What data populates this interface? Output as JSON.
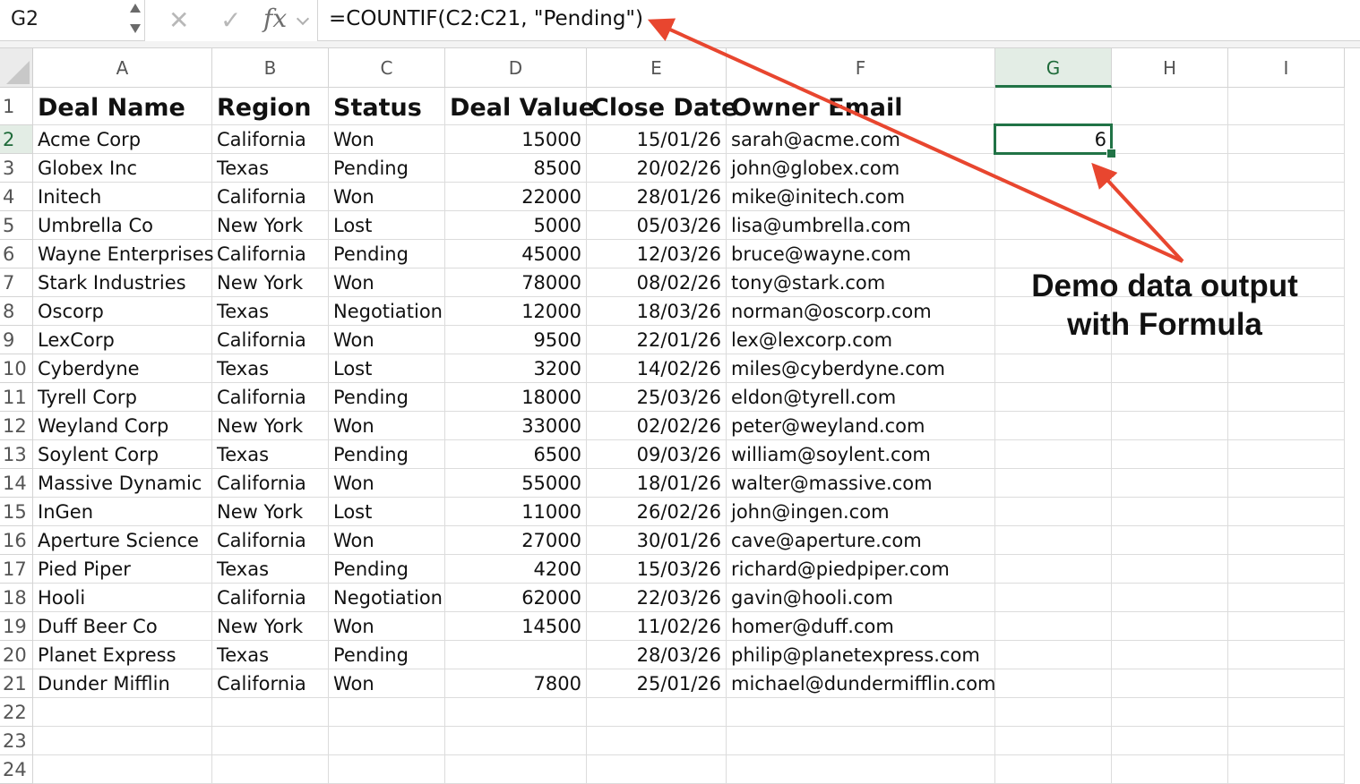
{
  "name_box": {
    "value": "G2"
  },
  "formula_bar": {
    "cancel_icon": "x-icon",
    "enter_icon": "check-icon",
    "fx_label": "fx",
    "formula": "=COUNTIF(C2:C21, \"Pending\")"
  },
  "columns": [
    "A",
    "B",
    "C",
    "D",
    "E",
    "F",
    "G",
    "H",
    "I"
  ],
  "selected_column": "G",
  "selected_row": 2,
  "row_numbers": [
    1,
    2,
    3,
    4,
    5,
    6,
    7,
    8,
    9,
    10,
    11,
    12,
    13,
    14,
    15,
    16,
    17,
    18,
    19,
    20,
    21,
    22,
    23,
    24
  ],
  "header_row": [
    "Deal Name",
    "Region",
    "Status",
    "Deal Value",
    "Close Date",
    "Owner Email"
  ],
  "rows": [
    [
      "Acme Corp",
      "California",
      "Won",
      "15000",
      "15/01/26",
      "sarah@acme.com"
    ],
    [
      "Globex Inc",
      "Texas",
      "Pending",
      "8500",
      "20/02/26",
      "john@globex.com"
    ],
    [
      "Initech",
      "California",
      "Won",
      "22000",
      "28/01/26",
      "mike@initech.com"
    ],
    [
      "Umbrella Co",
      "New York",
      "Lost",
      "5000",
      "05/03/26",
      "lisa@umbrella.com"
    ],
    [
      "Wayne Enterprises",
      "California",
      "Pending",
      "45000",
      "12/03/26",
      "bruce@wayne.com"
    ],
    [
      "Stark Industries",
      "New York",
      "Won",
      "78000",
      "08/02/26",
      "tony@stark.com"
    ],
    [
      "Oscorp",
      "Texas",
      "Negotiation",
      "12000",
      "18/03/26",
      "norman@oscorp.com"
    ],
    [
      "LexCorp",
      "California",
      "Won",
      "9500",
      "22/01/26",
      "lex@lexcorp.com"
    ],
    [
      "Cyberdyne",
      "Texas",
      "Lost",
      "3200",
      "14/02/26",
      "miles@cyberdyne.com"
    ],
    [
      "Tyrell Corp",
      "California",
      "Pending",
      "18000",
      "25/03/26",
      "eldon@tyrell.com"
    ],
    [
      "Weyland Corp",
      "New York",
      "Won",
      "33000",
      "02/02/26",
      "peter@weyland.com"
    ],
    [
      "Soylent Corp",
      "Texas",
      "Pending",
      "6500",
      "09/03/26",
      "william@soylent.com"
    ],
    [
      "Massive Dynamic",
      "California",
      "Won",
      "55000",
      "18/01/26",
      "walter@massive.com"
    ],
    [
      "InGen",
      "New York",
      "Lost",
      "11000",
      "26/02/26",
      "john@ingen.com"
    ],
    [
      "Aperture Science",
      "California",
      "Won",
      "27000",
      "30/01/26",
      "cave@aperture.com"
    ],
    [
      "Pied Piper",
      "Texas",
      "Pending",
      "4200",
      "15/03/26",
      "richard@piedpiper.com"
    ],
    [
      "Hooli",
      "California",
      "Negotiation",
      "62000",
      "22/03/26",
      "gavin@hooli.com"
    ],
    [
      "Duff Beer Co",
      "New York",
      "Won",
      "14500",
      "11/02/26",
      "homer@duff.com"
    ],
    [
      "Planet Express",
      "Texas",
      "Pending",
      "",
      "28/03/26",
      "philip@planetexpress.com"
    ],
    [
      "Dunder Mifflin",
      "California",
      "Won",
      "7800",
      "25/01/26",
      "michael@dundermifflin.com"
    ]
  ],
  "result_cell": {
    "ref": "G2",
    "value": "6"
  },
  "annotation": {
    "line1": "Demo data output",
    "line2": "with Formula",
    "arrow_color": "#e8462f"
  },
  "colors": {
    "selection": "#217346",
    "header_selected_bg": "#e3ede5"
  }
}
